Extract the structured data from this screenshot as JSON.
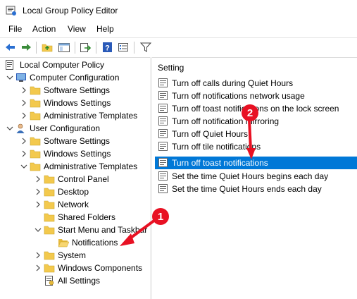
{
  "window": {
    "title": "Local Group Policy Editor"
  },
  "menu": [
    "File",
    "Action",
    "View",
    "Help"
  ],
  "toolbar_icons": [
    "back-icon",
    "forward-icon",
    "up-folder-icon",
    "show-hide-tree-icon",
    "export-list-icon",
    "help-icon",
    "properties-icon",
    "filter-icon"
  ],
  "tree": {
    "root": "Local Computer Policy",
    "computer_configuration": "Computer Configuration",
    "cc_software": "Software Settings",
    "cc_windows": "Windows Settings",
    "cc_admin": "Administrative Templates",
    "user_configuration": "User Configuration",
    "uc_software": "Software Settings",
    "uc_windows": "Windows Settings",
    "uc_admin": "Administrative Templates",
    "control_panel": "Control Panel",
    "desktop": "Desktop",
    "network": "Network",
    "shared_folders": "Shared Folders",
    "start_menu": "Start Menu and Taskbar",
    "notifications": "Notifications",
    "system": "System",
    "windows_components": "Windows Components",
    "all_settings": "All Settings"
  },
  "settings": {
    "column_header": "Setting",
    "items": [
      "Turn off calls during Quiet Hours",
      "Turn off notifications network usage",
      "Turn off toast notifications on the lock screen",
      "Turn off notification mirroring",
      "Turn off Quiet Hours",
      "Turn off tile notifications",
      "Turn off toast notifications",
      "Set the time Quiet Hours begins each day",
      "Set the time Quiet Hours ends each day"
    ],
    "selected": "Turn off toast notifications"
  },
  "annotations": {
    "marker1": "1",
    "marker2": "2",
    "color": "#e81123"
  },
  "colors": {
    "selection": "#0078d7",
    "folder": "#f3c94d"
  }
}
